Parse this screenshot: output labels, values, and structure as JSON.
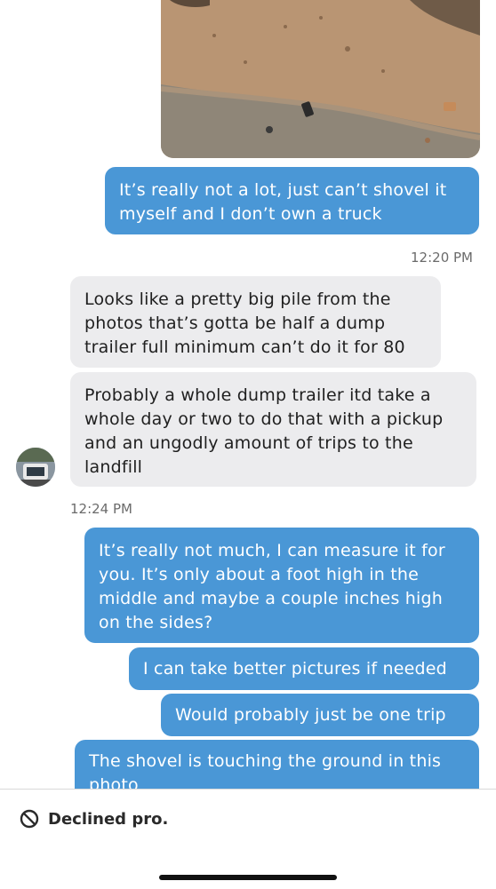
{
  "messages": [
    {
      "text": "It’s really not a lot, just can’t shovel it myself and I don’t own a truck"
    },
    {
      "text": "Looks like a pretty big pile from the photos that’s gotta be half a dump trailer full minimum can’t do it for 80"
    },
    {
      "text": "Probably a whole dump trailer itd take a whole day or two to do that with a pickup and an ungodly amount of trips to the landfill"
    },
    {
      "text": "It’s really not much, I can measure it for you. It’s only about a foot high in the middle and maybe a couple inches high on the sides?"
    },
    {
      "text": "I can take better pictures if needed"
    },
    {
      "text": "Would probably just be one trip"
    },
    {
      "text": "The shovel is touching the ground in this photo"
    }
  ],
  "timestamps": [
    "12:20 PM",
    "12:24 PM"
  ],
  "footer": {
    "status_label": "Declined pro.",
    "status_icon": "prohibited-icon"
  }
}
